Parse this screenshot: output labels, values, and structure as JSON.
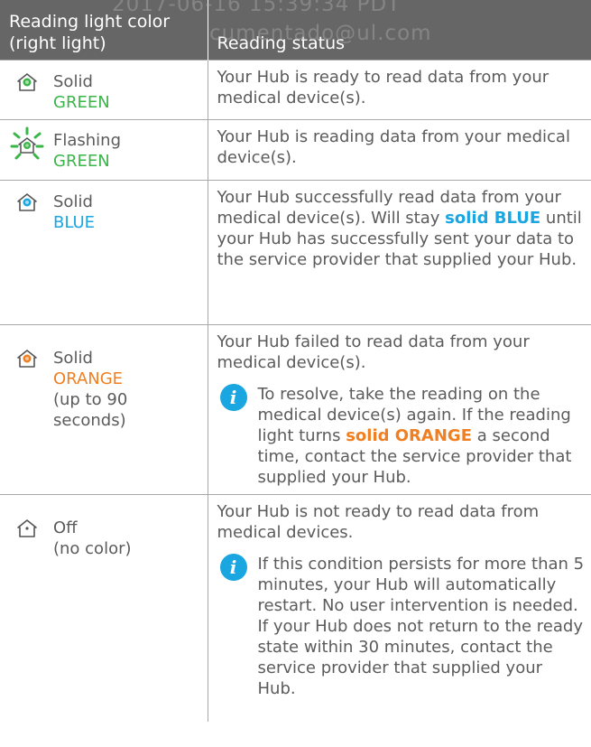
{
  "watermark": {
    "line1": "2017-06-16 15:39:34 PDT",
    "line2": "cumentado@ul.com"
  },
  "header": {
    "col1": "Reading light color (right light)",
    "col2": "Reading status"
  },
  "colors": {
    "green": "#3ab54a",
    "blue": "#1aa6e0",
    "orange": "#f07f22",
    "header_bg": "#666666"
  },
  "rows": [
    {
      "icon": "house-light-green-icon",
      "state": "Solid",
      "color": "GREEN",
      "desc": "Your Hub is ready to read data from your medical device(s)."
    },
    {
      "icon": "house-light-green-flashing-icon",
      "state": "Flashing",
      "color": "GREEN",
      "desc": "Your Hub is reading data from your medical device(s)."
    },
    {
      "icon": "house-light-blue-icon",
      "state": "Solid",
      "color": "BLUE",
      "desc_a": "Your Hub successfully read data from your medical device(s). Will stay",
      "desc_bold": "solid BLUE",
      "desc_b": "until your Hub has successfully sent your data to the service provider that supplied your Hub."
    },
    {
      "icon": "house-light-orange-icon",
      "state": "Solid",
      "color": "ORANGE",
      "extra": "(up to 90 seconds)",
      "desc": "Your Hub failed to read data from your medical device(s).",
      "note_a": "To resolve, take the reading on the medical device(s) again. If the reading light turns",
      "note_bold": "solid ORANGE",
      "note_b": "a second time, contact the service provider that supplied your Hub."
    },
    {
      "icon": "house-light-off-icon",
      "state": "Off",
      "extra": "(no color)",
      "desc": "Your Hub is not ready to read data from medical devices.",
      "note": "If this condition persists for more than 5 minutes, your Hub will automatically restart. No user intervention is needed. If your Hub does not return to the ready state within 30 minutes, contact the service provider that supplied your Hub."
    }
  ],
  "info_glyph": "i"
}
